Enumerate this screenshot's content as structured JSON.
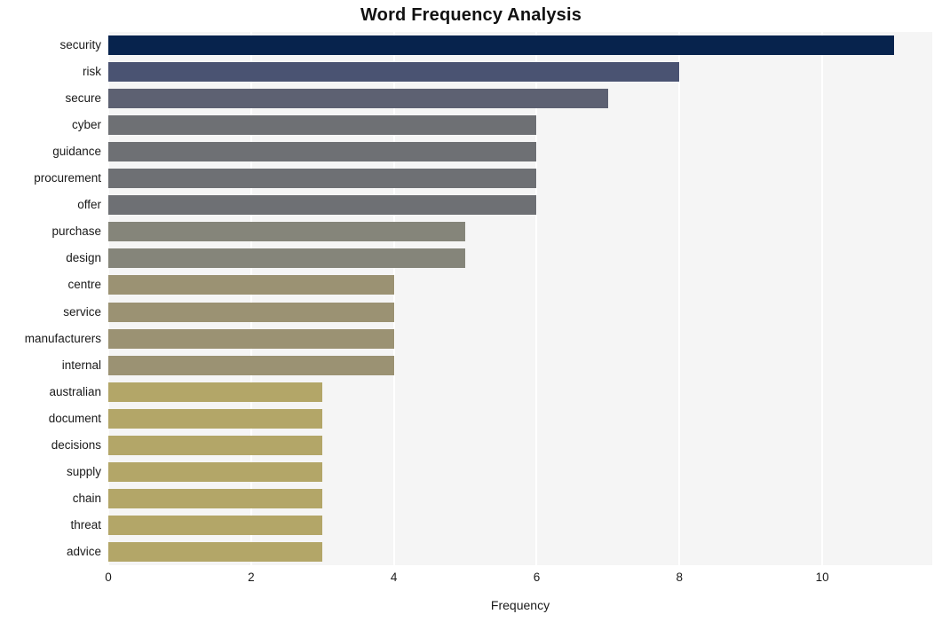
{
  "chart_data": {
    "type": "bar",
    "orientation": "horizontal",
    "title": "Word Frequency Analysis",
    "xlabel": "Frequency",
    "ylabel": "",
    "categories": [
      "security",
      "risk",
      "secure",
      "cyber",
      "guidance",
      "procurement",
      "offer",
      "purchase",
      "design",
      "centre",
      "service",
      "manufacturers",
      "internal",
      "australian",
      "document",
      "decisions",
      "supply",
      "chain",
      "threat",
      "advice"
    ],
    "values": [
      11,
      8,
      7,
      6,
      6,
      6,
      6,
      5,
      5,
      4,
      4,
      4,
      4,
      3,
      3,
      3,
      3,
      3,
      3,
      3
    ],
    "bar_colors": [
      "#07234d",
      "#4a5372",
      "#5d6172",
      "#6e7074",
      "#6e7074",
      "#6e7074",
      "#6e7074",
      "#85857a",
      "#85857a",
      "#9b9273",
      "#9b9273",
      "#9b9273",
      "#9b9273",
      "#b3a668",
      "#b3a668",
      "#b3a668",
      "#b3a668",
      "#b3a668",
      "#b3a668",
      "#b3a668"
    ],
    "xticks": [
      0,
      2,
      4,
      6,
      8,
      10
    ],
    "xtick_labels": [
      "0",
      "2",
      "4",
      "6",
      "8",
      "10"
    ],
    "xlim": [
      0,
      11.54
    ],
    "grid": true,
    "grid_axis": "x",
    "legend": null,
    "plot_background": "#f5f5f5",
    "figure_background": "#ffffff",
    "gridline_color": "#ffffff",
    "title_color": "#111111",
    "tick_label_color": "#1a1a1a"
  }
}
